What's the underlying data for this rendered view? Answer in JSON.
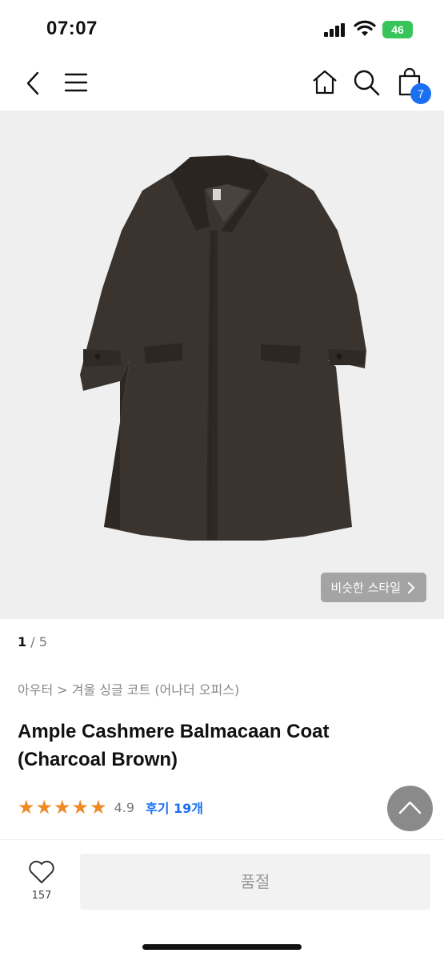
{
  "status_bar": {
    "time": "07:07",
    "battery": "46"
  },
  "nav": {
    "cart_count": "7"
  },
  "gallery": {
    "similar_style_label": "비슷한 스타일",
    "current": "1",
    "separator": " / ",
    "total": "5"
  },
  "product": {
    "breadcrumb": "아우터 > 겨울 싱글 코트 (어나더 오피스)",
    "title": "Ample Cashmere Balmacaan Coat (Charcoal Brown)",
    "stars": "★★★★★",
    "rating": "4.9",
    "reviews_label": "후기 19개"
  },
  "bottom_bar": {
    "like_count": "157",
    "action_label": "품절"
  },
  "colors": {
    "accent": "#1a6ff2",
    "star": "#f08a24",
    "coat": "#3a332e"
  }
}
